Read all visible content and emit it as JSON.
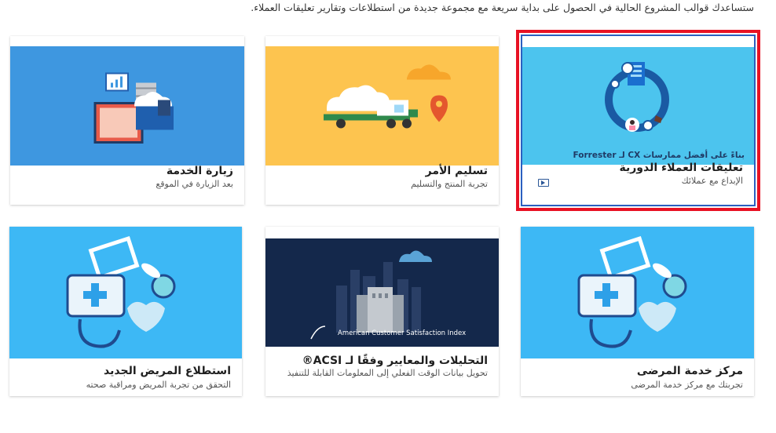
{
  "intro_text": "ستساعدك قوالب المشروع الحالية في الحصول على بداية سريعة مع مجموعة جديدة من استطلاعات وتقارير تعليقات العملاء.",
  "cards": [
    {
      "title": "تعليقات العملاء الدورية",
      "subtitle": "الإبداع مع عملائك",
      "overlay_caption": "بناءً على أفضل ممارسات CX لـ Forrester",
      "thumb_color": "#4cc4ee",
      "selected": true,
      "has_video": true
    },
    {
      "title": "تسليم الأمر",
      "subtitle": "تجربة المنتج والتسليم",
      "thumb_color": "#fdc44f"
    },
    {
      "title": "زيارة الخدمة",
      "subtitle": "بعد الزيارة في الموقع",
      "thumb_color": "#3e97e0"
    },
    {
      "title": "مركز خدمة المرضى",
      "subtitle": "تجربتك مع مركز خدمة المرضى",
      "thumb_color": "#3db8f5"
    },
    {
      "title": "التحليلات والمعايير وفقًا لـ ACSI®",
      "subtitle": "تحويل بيانات الوقت الفعلي إلى المعلومات القابلة للتنفيذ",
      "overlay_caption": "American Customer Satisfaction Index",
      "thumb_color": "#14284b"
    },
    {
      "title": "استطلاع المريض الجديد",
      "subtitle": "التحقق من تجربة المريض ومراقبة صحته",
      "thumb_color": "#3db8f5"
    }
  ],
  "icons": {
    "video": "play-video-icon"
  }
}
